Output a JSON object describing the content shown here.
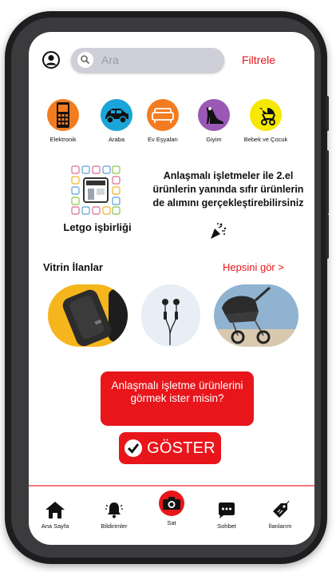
{
  "header": {
    "search_placeholder": "Ara",
    "filter_label": "Filtrele"
  },
  "categories": [
    {
      "label": "Elektronik",
      "icon": "phone-icon",
      "color": "#f47c20"
    },
    {
      "label": "Araba",
      "icon": "car-icon",
      "color": "#1aa4d8"
    },
    {
      "label": "Ev Eşyaları",
      "icon": "sofa-icon",
      "color": "#f47c20"
    },
    {
      "label": "Giyim",
      "icon": "shoe-icon",
      "color": "#9a59b5"
    },
    {
      "label": "Bebek ve Çocuk",
      "icon": "stroller-icon",
      "color": "#f6e800"
    }
  ],
  "partnership": {
    "title": "Letgo işbirliği",
    "text": "Anlaşmalı işletmeler ile 2.el ürünlerin yanında sıfır ürünlerin de alımını gerçekleştirebilirsiniz"
  },
  "showcase": {
    "title": "Vitrin İlanlar",
    "see_all": "Hepsini gör  >",
    "items": [
      {
        "name": "powerbank",
        "bg": "#f5b51c"
      },
      {
        "name": "earphones",
        "bg": "#e8eef5"
      },
      {
        "name": "stroller",
        "bg": "#8fb3d1"
      }
    ]
  },
  "cta": {
    "question": "Anlaşmalı işletme ürünlerini görmek ister misin?",
    "button": "GÖSTER"
  },
  "nav": {
    "home": "Ana Sayfa",
    "notifications": "Bildirimler",
    "sell": "Sat",
    "chat": "Sohbet",
    "listings": "İlanlarım"
  },
  "colors": {
    "accent": "#e8151a",
    "search_bg": "#cfcfd9"
  }
}
